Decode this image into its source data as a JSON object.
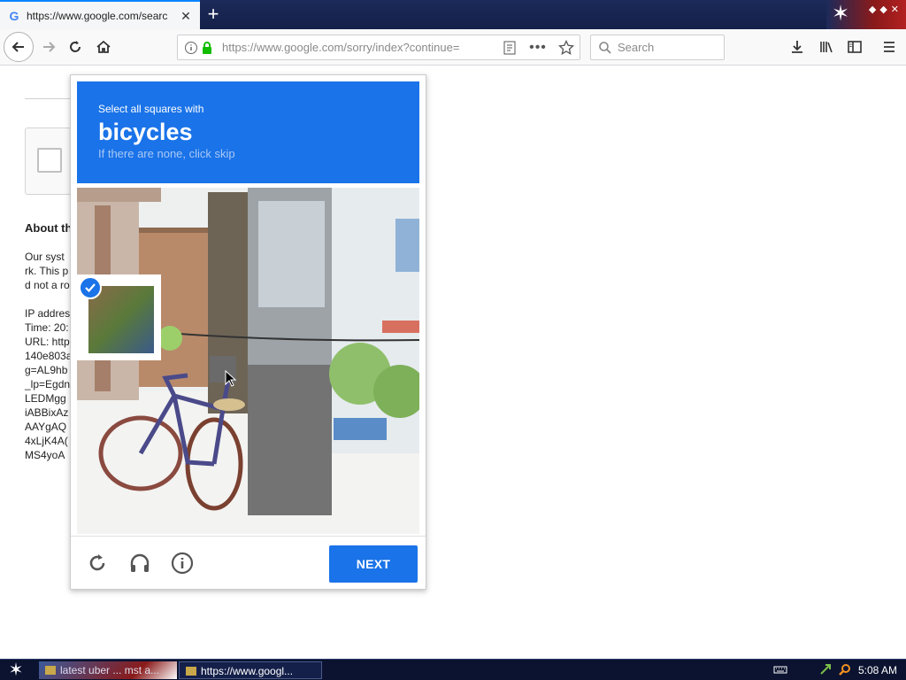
{
  "browser": {
    "tab": {
      "favicon": "G",
      "title": "https://www.google.com/search?q=",
      "close": "✕"
    },
    "new_tab": "+",
    "url": "https://www.google.com/sorry/index?continue=",
    "search_placeholder": "Search"
  },
  "page": {
    "about_heading": "About th",
    "about_body": "Our syst\nrk. This p\nd not a ro\n\nIP addres\nTime: 20:\nURL: http\n140e803a\ng=AL9hb\n_lp=Egdn\nLEDMgg\niABBixAz\nAAYgAQ\n4xLjK4A(\nMS4yoA"
  },
  "challenge": {
    "instruction": "Select all squares with",
    "target": "bicycles",
    "skip_hint": "If there are none, click skip",
    "selected_tiles": [
      4
    ],
    "grid_size": 4,
    "next_label": "NEXT",
    "icons": [
      "reload-icon",
      "headphones-icon",
      "info-icon"
    ]
  },
  "taskbar": {
    "items": [
      "latest uber ... mst a...",
      "https://www.googl..."
    ],
    "time": "5:08 AM"
  },
  "colors": {
    "accent": "#1a73e8",
    "tabstrip": "#1c2a5a",
    "taskbar": "#0b1330"
  }
}
